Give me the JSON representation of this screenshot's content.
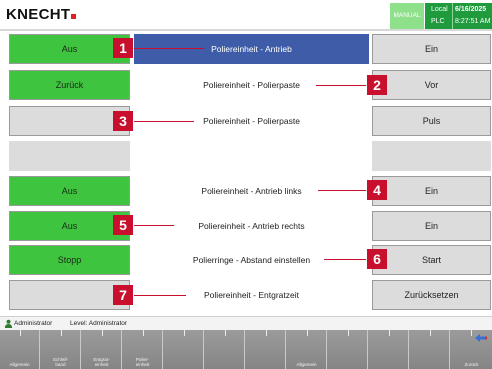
{
  "header": {
    "logo": "KNECHT",
    "mode": "MANUAL",
    "local_label": "Local",
    "plc_label": "PLC",
    "date": "6/16/2025",
    "time": "8:27:51 AM"
  },
  "rows": [
    {
      "left": "Aus",
      "label": "Poliereinheit - Antrieb",
      "right": "Ein",
      "callout": "1"
    },
    {
      "left": "Zurück",
      "label": "Poliereinheit - Polierpaste",
      "right": "Vor",
      "callout": "2"
    },
    {
      "left": "",
      "label": "Poliereinheit - Polierpaste",
      "right": "Puls",
      "callout": "3"
    },
    {
      "left": "",
      "label": "",
      "right": ""
    },
    {
      "left": "Aus",
      "label": "Poliereinheit - Antrieb links",
      "right": "Ein",
      "callout": "4"
    },
    {
      "left": "Aus",
      "label": "Poliereinheit - Antrieb rechts",
      "right": "Ein",
      "callout": "5"
    },
    {
      "left": "Stopp",
      "label": "Polierringe - Abstand einstellen",
      "right": "Start",
      "callout": "6"
    },
    {
      "left": "",
      "label": "Poliereinheit - Entgratzeit",
      "right": "Zurücksetzen",
      "callout": "7"
    }
  ],
  "footer": {
    "user": "Administrator",
    "level": "Level: Administrator",
    "fkeys": [
      "Allgemein",
      "Schleif-\nband",
      "Entgrat-\neinheit",
      "Polier-\neinheit",
      "",
      "",
      "",
      "Allgemein",
      "",
      "",
      "",
      "Zurück"
    ]
  },
  "colors": {
    "green": "#3ec43e",
    "selected": "#3e5ca8",
    "callout": "#c8102e",
    "status": "#1f9a3d"
  },
  "icons": {
    "user": "user-icon",
    "arrow": "arrow-icon"
  }
}
